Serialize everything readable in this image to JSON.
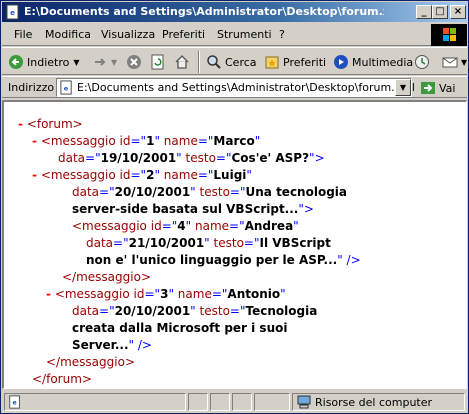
{
  "window": {
    "title": "E:\\Documents and Settings\\Administrator\\Desktop\\forum.xml - M...",
    "min_label": "_",
    "max_label": "□",
    "close_label": "×"
  },
  "menu": {
    "items": [
      {
        "label": "File"
      },
      {
        "label": "Modifica"
      },
      {
        "label": "Visualizza"
      },
      {
        "label": "Preferiti"
      },
      {
        "label": "Strumenti"
      },
      {
        "label": "?"
      }
    ]
  },
  "toolbar": {
    "back_label": "Indietro",
    "search_label": "Cerca",
    "favorites_label": "Preferiti",
    "multimedia_label": "Multimedia"
  },
  "address": {
    "label": "Indirizzo",
    "value": "E:\\Documents and Settings\\Administrator\\Desktop\\forum.xml",
    "go_label": "Vai"
  },
  "xml": {
    "lines": [
      {
        "minus": "-",
        "tag_open": "<forum>"
      },
      {
        "minus": "-",
        "tag_open": "<messaggio",
        "a1": "id",
        "v1": "1",
        "a2": "name",
        "v2": "Marco"
      },
      {
        "a1": "data",
        "v1": "19/10/2001",
        "a2": "testo",
        "v2": "Cos'e' ASP?",
        "end": "\">"
      },
      {
        "minus": "-",
        "tag_open": "<messaggio",
        "a1": "id",
        "v1": "2",
        "a2": "name",
        "v2": "Luigi"
      },
      {
        "a1": "data",
        "v1": "20/10/2001",
        "a2": "testo",
        "v2": "Una tecnologia"
      },
      {
        "text": "server-side basata sul VBScript...",
        "end": "\">"
      },
      {
        "tag_open": "<messaggio",
        "a1": "id",
        "v1": "4",
        "a2": "name",
        "v2": "Andrea"
      },
      {
        "a1": "data",
        "v1": "21/10/2001",
        "a2": "testo",
        "v2": "Il VBScript"
      },
      {
        "text": "non e' l'unico linguaggio per le ASP...",
        "end": "\" />"
      },
      {
        "tag_close": "</messaggio>"
      },
      {
        "minus": "-",
        "tag_open": "<messaggio",
        "a1": "id",
        "v1": "3",
        "a2": "name",
        "v2": "Antonio"
      },
      {
        "a1": "data",
        "v1": "20/10/2001",
        "a2": "testo",
        "v2": "Tecnologia"
      },
      {
        "text": "creata dalla Microsoft per i suoi"
      },
      {
        "text": "Server...",
        "end": "\" />"
      },
      {
        "tag_close": "</messaggio>"
      },
      {
        "tag_close": "</forum>"
      }
    ]
  },
  "status": {
    "zone_label": "Risorse del computer"
  },
  "colors": {
    "title_gradient_start": "#0a246a",
    "title_gradient_end": "#a6caf0",
    "xml_tag": "#990000",
    "xml_minus": "#ff0000",
    "xml_punct": "#0000ff"
  }
}
